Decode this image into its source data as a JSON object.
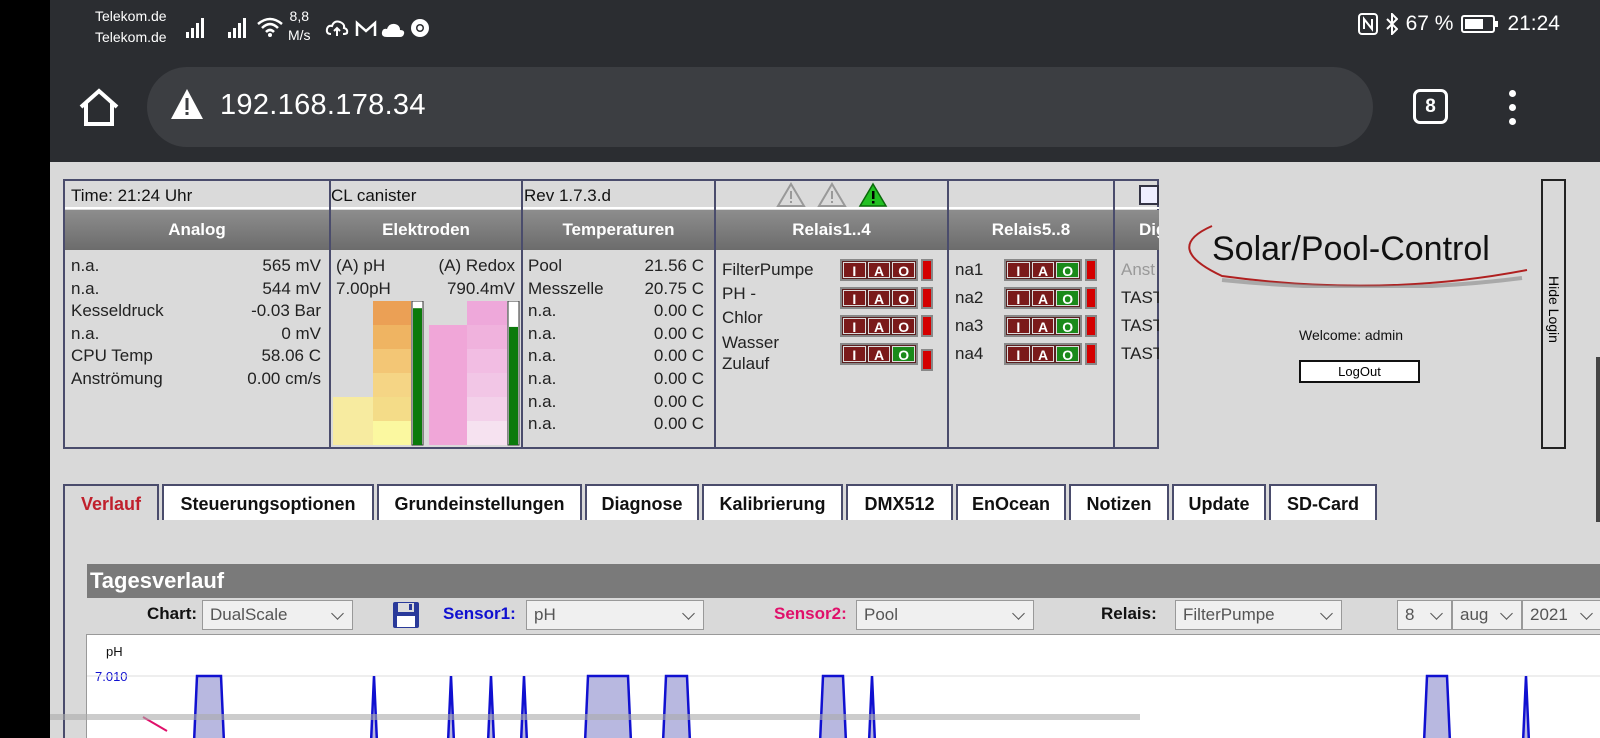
{
  "statusbar": {
    "carrier1": "Telekom.de",
    "carrier2": "Telekom.de",
    "speed_value": "8,8",
    "speed_unit": "M/s",
    "battery": "67 %",
    "time": "21:24"
  },
  "browser": {
    "url": "192.168.178.34",
    "tab_count": "8"
  },
  "panel": {
    "time": "Time: 21:24 Uhr",
    "canister": "CL canister",
    "rev": "Rev 1.7.3.d",
    "headers": {
      "analog": "Analog",
      "elektroden": "Elektroden",
      "temperaturen": "Temperaturen",
      "relais1": "Relais1..4",
      "relais5": "Relais5..8",
      "dig": "Dig"
    },
    "analog": [
      {
        "label": "n.a.",
        "value": "565 mV"
      },
      {
        "label": "n.a.",
        "value": "544 mV"
      },
      {
        "label": "Kesseldruck",
        "value": "-0.03 Bar"
      },
      {
        "label": "n.a.",
        "value": "0 mV"
      },
      {
        "label": "CPU Temp",
        "value": "58.06 C"
      },
      {
        "label": "Anströmung",
        "value": "0.00 cm/s"
      }
    ],
    "elektroden": {
      "ph_label": "(A) pH",
      "ph_value": "7.00pH",
      "redox_label": "(A) Redox",
      "redox_value": "790.4mV",
      "ph_level": 0.95,
      "redox_level": 0.82
    },
    "temperaturen": [
      {
        "label": "Pool",
        "value": "21.56 C"
      },
      {
        "label": "Messzelle",
        "value": "20.75 C"
      },
      {
        "label": "n.a.",
        "value": "0.00 C"
      },
      {
        "label": "n.a.",
        "value": "0.00 C"
      },
      {
        "label": "n.a.",
        "value": "0.00 C"
      },
      {
        "label": "n.a.",
        "value": "0.00 C"
      },
      {
        "label": "n.a.",
        "value": "0.00 C"
      },
      {
        "label": "n.a.",
        "value": "0.00 C"
      }
    ],
    "relais1": [
      {
        "label": "FilterPumpe"
      },
      {
        "label": "PH -"
      },
      {
        "label": "Chlor"
      },
      {
        "label": "Wasser Zulauf"
      }
    ],
    "relais5": [
      {
        "label": "na1"
      },
      {
        "label": "na2"
      },
      {
        "label": "na3"
      },
      {
        "label": "na4"
      }
    ],
    "relay_buttons": {
      "i": "I",
      "a": "A",
      "o": "O"
    },
    "dig": [
      "Anst",
      "TAST",
      "TAST",
      "TAST"
    ]
  },
  "login": {
    "logo_text": "Solar/Pool-Control",
    "welcome": "Welcome:  admin",
    "logout": "LogOut",
    "hide": "Hide Login"
  },
  "tabs": [
    "Verlauf",
    "Steuerungsoptionen",
    "Grundeinstellungen",
    "Diagnose",
    "Kalibrierung",
    "DMX512",
    "EnOcean",
    "Notizen",
    "Update",
    "SD-Card"
  ],
  "tagesverlauf": {
    "title": "Tagesverlauf",
    "chart_label": "Chart:",
    "chart_value": "DualScale",
    "sensor1_label": "Sensor1:",
    "sensor1_value": "pH",
    "sensor2_label": "Sensor2:",
    "sensor2_value": "Pool",
    "relais_label": "Relais:",
    "relais_value": "FilterPumpe",
    "day": "8",
    "month": "aug",
    "year": "2021"
  },
  "chart": {
    "ylabel": "pH",
    "ytick": "7.010",
    "colors": {
      "line": "#1010d0",
      "fill": "#b8b8e0"
    }
  }
}
